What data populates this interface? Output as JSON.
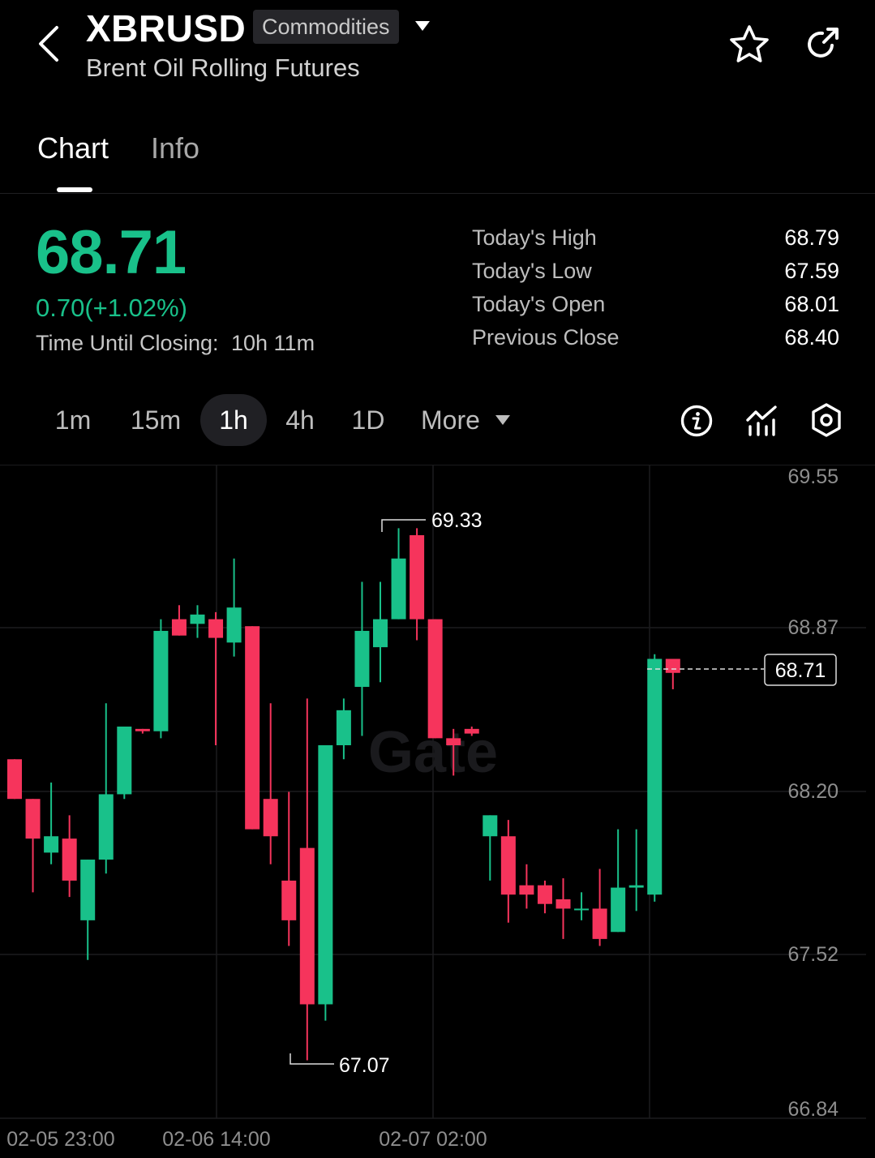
{
  "header": {
    "symbol": "XBRUSD",
    "category_tag": "Commodities",
    "subtitle": "Brent Oil Rolling Futures",
    "icons": [
      "chevron-left-icon",
      "caret-down-icon",
      "star-icon",
      "share-icon"
    ]
  },
  "tabs": [
    {
      "label": "Chart",
      "active": true
    },
    {
      "label": "Info",
      "active": false
    }
  ],
  "quote": {
    "price": "68.71",
    "change": "0.70(+1.02%)",
    "closing_label": "Time Until Closing:",
    "closing_value": "10h 11m"
  },
  "stats": [
    {
      "label": "Today's High",
      "value": "68.79"
    },
    {
      "label": "Today's Low",
      "value": "67.59"
    },
    {
      "label": "Today's Open",
      "value": "68.01"
    },
    {
      "label": "Previous Close",
      "value": "68.40"
    }
  ],
  "timeframes": [
    {
      "label": "1m",
      "active": false
    },
    {
      "label": "15m",
      "active": false
    },
    {
      "label": "1h",
      "active": true
    },
    {
      "label": "4h",
      "active": false
    },
    {
      "label": "1D",
      "active": false
    }
  ],
  "more_label": "More",
  "toolbar_icons": [
    "info-icon",
    "indicators-icon",
    "settings-icon"
  ],
  "colors": {
    "up": "#19c18a",
    "down": "#f6345c",
    "background": "#000000",
    "grid": "#1c1c1f"
  },
  "chart_data": {
    "type": "candlestick",
    "y_ticks": [
      "69.55",
      "68.87",
      "68.20",
      "67.52",
      "66.84"
    ],
    "x_ticks": [
      "02-05 23:00",
      "02-06 14:00",
      "02-07 02:00"
    ],
    "ylim": [
      66.84,
      69.55
    ],
    "high_marker": "69.33",
    "low_marker": "67.07",
    "last_price_label": "68.71",
    "candles": [
      {
        "o": 68.34,
        "h": 68.34,
        "l": 68.17,
        "c": 68.17
      },
      {
        "o": 68.17,
        "h": 68.17,
        "l": 67.77,
        "c": 68.0
      },
      {
        "o": 67.94,
        "h": 68.24,
        "l": 67.89,
        "c": 68.01
      },
      {
        "o": 68.0,
        "h": 68.1,
        "l": 67.75,
        "c": 67.82
      },
      {
        "o": 67.65,
        "h": 67.82,
        "l": 67.48,
        "c": 67.91
      },
      {
        "o": 67.91,
        "h": 68.58,
        "l": 67.85,
        "c": 68.19
      },
      {
        "o": 68.19,
        "h": 68.36,
        "l": 68.17,
        "c": 68.48
      },
      {
        "o": 68.47,
        "h": 68.47,
        "l": 68.45,
        "c": 68.46
      },
      {
        "o": 68.46,
        "h": 68.94,
        "l": 68.43,
        "c": 68.89
      },
      {
        "o": 68.94,
        "h": 69.0,
        "l": 68.89,
        "c": 68.87
      },
      {
        "o": 68.92,
        "h": 69.0,
        "l": 68.86,
        "c": 68.96
      },
      {
        "o": 68.94,
        "h": 68.97,
        "l": 68.4,
        "c": 68.86
      },
      {
        "o": 68.84,
        "h": 69.2,
        "l": 68.78,
        "c": 68.99
      },
      {
        "o": 68.91,
        "h": 68.91,
        "l": 68.04,
        "c": 68.04
      },
      {
        "o": 68.17,
        "h": 68.58,
        "l": 67.89,
        "c": 68.01
      },
      {
        "o": 67.82,
        "h": 68.2,
        "l": 67.54,
        "c": 67.65
      },
      {
        "o": 67.96,
        "h": 68.6,
        "l": 67.05,
        "c": 67.29
      },
      {
        "o": 67.29,
        "h": 68.34,
        "l": 67.22,
        "c": 68.4
      },
      {
        "o": 68.4,
        "h": 68.6,
        "l": 68.34,
        "c": 68.55
      },
      {
        "o": 68.65,
        "h": 69.1,
        "l": 68.44,
        "c": 68.89
      },
      {
        "o": 68.82,
        "h": 69.1,
        "l": 68.67,
        "c": 68.94
      },
      {
        "o": 68.94,
        "h": 69.33,
        "l": 69.0,
        "c": 69.2
      },
      {
        "o": 69.3,
        "h": 69.33,
        "l": 68.85,
        "c": 68.94
      },
      {
        "o": 68.94,
        "h": 68.94,
        "l": 68.43,
        "c": 68.43
      },
      {
        "o": 68.43,
        "h": 68.47,
        "l": 68.27,
        "c": 68.4
      },
      {
        "o": 68.47,
        "h": 68.48,
        "l": 68.44,
        "c": 68.45
      },
      {
        "o": 68.01,
        "h": 68.07,
        "l": 67.82,
        "c": 68.1
      },
      {
        "o": 68.01,
        "h": 68.08,
        "l": 67.64,
        "c": 67.76
      },
      {
        "o": 67.8,
        "h": 67.89,
        "l": 67.7,
        "c": 67.76
      },
      {
        "o": 67.8,
        "h": 67.82,
        "l": 67.68,
        "c": 67.72
      },
      {
        "o": 67.74,
        "h": 67.83,
        "l": 67.57,
        "c": 67.7
      },
      {
        "o": 67.7,
        "h": 67.77,
        "l": 67.65,
        "c": 67.7
      },
      {
        "o": 67.7,
        "h": 67.87,
        "l": 67.54,
        "c": 67.57
      },
      {
        "o": 67.6,
        "h": 68.04,
        "l": 67.6,
        "c": 67.79
      },
      {
        "o": 67.79,
        "h": 68.04,
        "l": 67.69,
        "c": 67.8
      },
      {
        "o": 67.76,
        "h": 68.79,
        "l": 67.73,
        "c": 68.77
      },
      {
        "o": 68.77,
        "h": 68.77,
        "l": 68.64,
        "c": 68.71
      }
    ]
  }
}
